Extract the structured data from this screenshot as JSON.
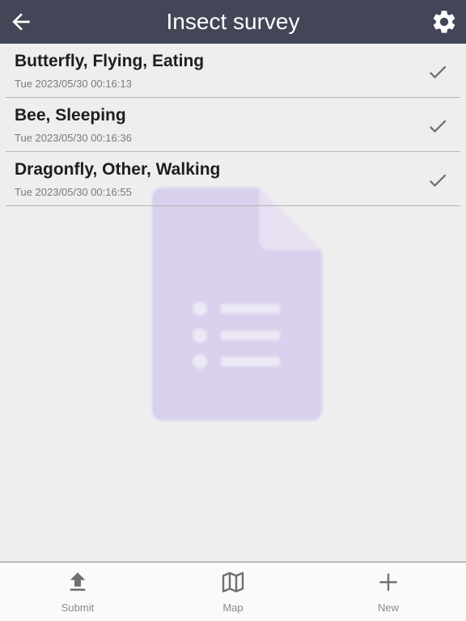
{
  "header": {
    "title": "Insect survey",
    "back_icon": "arrow-left-icon",
    "settings_icon": "gear-icon"
  },
  "survey_list": [
    {
      "name": "Butterfly, Flying, Eating",
      "date": "Tue 2023/05/30 00:16:13",
      "status_icon": "check-icon"
    },
    {
      "name": "Bee, Sleeping",
      "date": "Tue 2023/05/30 00:16:36",
      "status_icon": "check-icon"
    },
    {
      "name": "Dragonfly, Other, Walking",
      "date": "Tue 2023/05/30 00:16:55",
      "status_icon": "check-icon"
    }
  ],
  "bottom_nav": [
    {
      "label": "Submit",
      "icon": "upload-icon"
    },
    {
      "label": "Map",
      "icon": "map-icon"
    },
    {
      "label": "New",
      "icon": "plus-icon"
    }
  ],
  "colors": {
    "header_bg": "#434656",
    "background": "#eeeeee",
    "watermark": "#d8d0ec",
    "icon_gray": "#707070"
  }
}
